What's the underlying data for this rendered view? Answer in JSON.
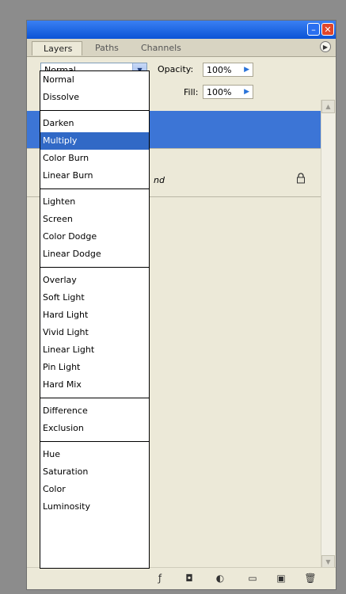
{
  "panel": {
    "tabs": [
      "Layers",
      "Paths",
      "Channels"
    ],
    "active_tab": "Layers"
  },
  "blend_mode": {
    "selected": "Normal"
  },
  "opacity": {
    "label": "Opacity:",
    "value": "100%"
  },
  "fill": {
    "label": "Fill:",
    "value": "100%"
  },
  "layers": {
    "background_partial": "nd"
  },
  "dropdown": {
    "highlighted": "Multiply",
    "groups": [
      [
        "Normal",
        "Dissolve"
      ],
      [
        "Darken",
        "Multiply",
        "Color Burn",
        "Linear Burn"
      ],
      [
        "Lighten",
        "Screen",
        "Color Dodge",
        "Linear Dodge"
      ],
      [
        "Overlay",
        "Soft Light",
        "Hard Light",
        "Vivid Light",
        "Linear Light",
        "Pin Light",
        "Hard Mix"
      ],
      [
        "Difference",
        "Exclusion"
      ],
      [
        "Hue",
        "Saturation",
        "Color",
        "Luminosity"
      ]
    ]
  },
  "colors": {
    "title_bar": "#0b53d6",
    "selection": "#3169c6",
    "panel_bg": "#ece9d8"
  },
  "bottom_icons": [
    "link-icon",
    "layer-style-icon",
    "mask-icon",
    "adjustment-icon",
    "group-icon",
    "new-layer-icon",
    "trash-icon"
  ]
}
